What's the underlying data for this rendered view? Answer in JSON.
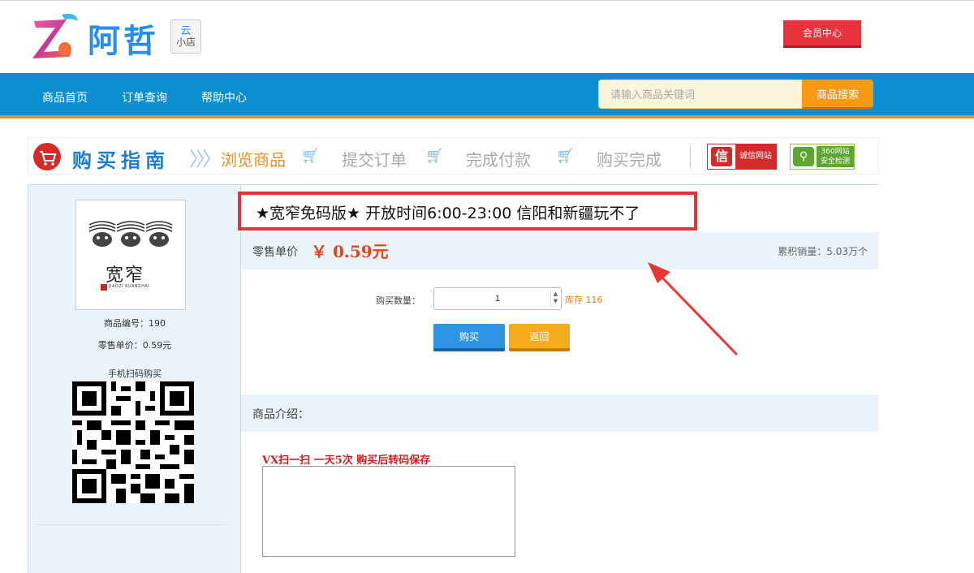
{
  "brand": {
    "name": "阿哲",
    "badge_top": "云",
    "badge_bottom": "小店"
  },
  "header": {
    "member_label": "会员中心"
  },
  "nav": {
    "items": [
      {
        "label": "商品首页"
      },
      {
        "label": "订单查询"
      },
      {
        "label": "帮助中心"
      }
    ],
    "search_placeholder": "请输入商品关键词",
    "search_label": "商品搜索"
  },
  "guide": {
    "title": "购买指南",
    "steps": [
      "浏览商品",
      "提交订单",
      "完成付款",
      "购买完成"
    ],
    "badge_credit": "诚信网站",
    "badge_credit_icon": "信",
    "badge_safe_line1": "360网站",
    "badge_safe_line2": "安全检测"
  },
  "product": {
    "title": "★宽窄免码版★ 开放时间6:00-23:00 信阳和新疆玩不了",
    "thumb_text": "宽窄",
    "thumb_sub": "JIAOZI KUANZHAI",
    "code_label": "商品编号：190",
    "unit_price_label": "零售单价：0.59元",
    "qr_label": "手机扫码购买",
    "price_label": "零售单价",
    "price_value": "￥ 0.59元",
    "sales": "累积销量：5.03万个",
    "qty_label": "购买数量：",
    "qty_value": "1",
    "stock": "库存 116",
    "buy_label": "购买",
    "back_label": "返回",
    "intro_label": "商品介绍：",
    "description": "VX扫一扫 一天5次 购买后转码保存"
  },
  "colors": {
    "nav_bg": "#0a8fd2",
    "accent_orange": "#f59a12",
    "highlight_red": "#e43237",
    "price_red": "#e8441a"
  }
}
